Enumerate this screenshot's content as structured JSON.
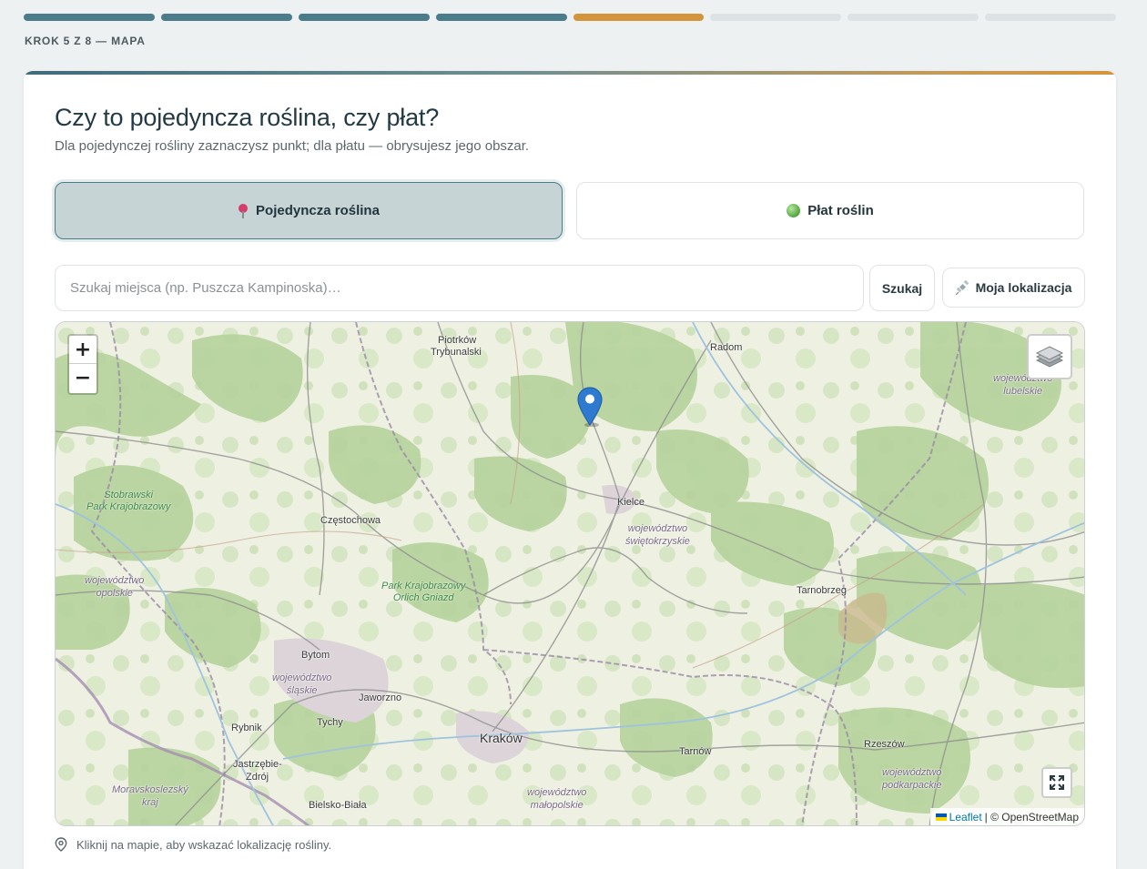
{
  "progress": {
    "segments": [
      "done",
      "done",
      "done",
      "done",
      "current",
      "todo",
      "todo",
      "todo"
    ],
    "step_label": "KROK 5 Z 8 — MAPA"
  },
  "colors": {
    "done": "#4a7c8b",
    "current": "#d4943b",
    "todo": "#dde3e5"
  },
  "question": {
    "title": "Czy to pojedyncza roślina, czy płat?",
    "subtitle": "Dla pojedynczej rośliny zaznaczysz punkt; dla płatu — obrysujesz jego obszar."
  },
  "choices": {
    "single": {
      "label": "Pojedyncza roślina",
      "icon": "pin-icon",
      "selected": true
    },
    "patch": {
      "label": "Płat roślin",
      "icon": "green-circle-icon",
      "selected": false
    }
  },
  "search": {
    "placeholder": "Szukaj miejsca (np. Puszcza Kampinoska)…",
    "search_button": "Szukaj",
    "location_button": "Moja lokalizacja"
  },
  "map": {
    "zoom_in": "+",
    "zoom_out": "−",
    "attribution_link": "Leaflet",
    "attribution_text": "| © OpenStreetMap",
    "cities": [
      {
        "name": "Piotrków",
        "cls": "city"
      },
      {
        "name": "Trybunalski",
        "cls": "city"
      },
      {
        "name": "Radom",
        "cls": "city"
      },
      {
        "name": "Kielce",
        "cls": "city"
      },
      {
        "name": "Częstochowa",
        "cls": "city"
      },
      {
        "name": "Tarnobrzeg",
        "cls": "city"
      },
      {
        "name": "Bytom",
        "cls": "city"
      },
      {
        "name": "Jaworzno",
        "cls": "city"
      },
      {
        "name": "Tychy",
        "cls": "city"
      },
      {
        "name": "Rybnik",
        "cls": "city"
      },
      {
        "name": "Jastrzębie-",
        "cls": "city"
      },
      {
        "name": "Zdrój",
        "cls": "city"
      },
      {
        "name": "Kraków",
        "cls": "city big"
      },
      {
        "name": "Tarnów",
        "cls": "city"
      },
      {
        "name": "Rzeszów",
        "cls": "city"
      },
      {
        "name": "Bielsko-Biała",
        "cls": "city"
      }
    ],
    "regions": [
      {
        "name": "województwo\nlubelskie"
      },
      {
        "name": "województwo\nświętokrzyskie"
      },
      {
        "name": "województwo\nopolskie"
      },
      {
        "name": "województwo\nśląskie"
      },
      {
        "name": "Moravskoslezský\nkraj"
      },
      {
        "name": "województwo\nmałopolskie"
      },
      {
        "name": "województwo\npodkarpackie"
      }
    ],
    "parks": [
      {
        "name": "Stobrawski\nPark Krajobrazowy"
      },
      {
        "name": "Park Krajobrazowy\nOrlich Gniazd"
      }
    ]
  },
  "hint": "Kliknij na mapie, aby wskazać lokalizację rośliny."
}
